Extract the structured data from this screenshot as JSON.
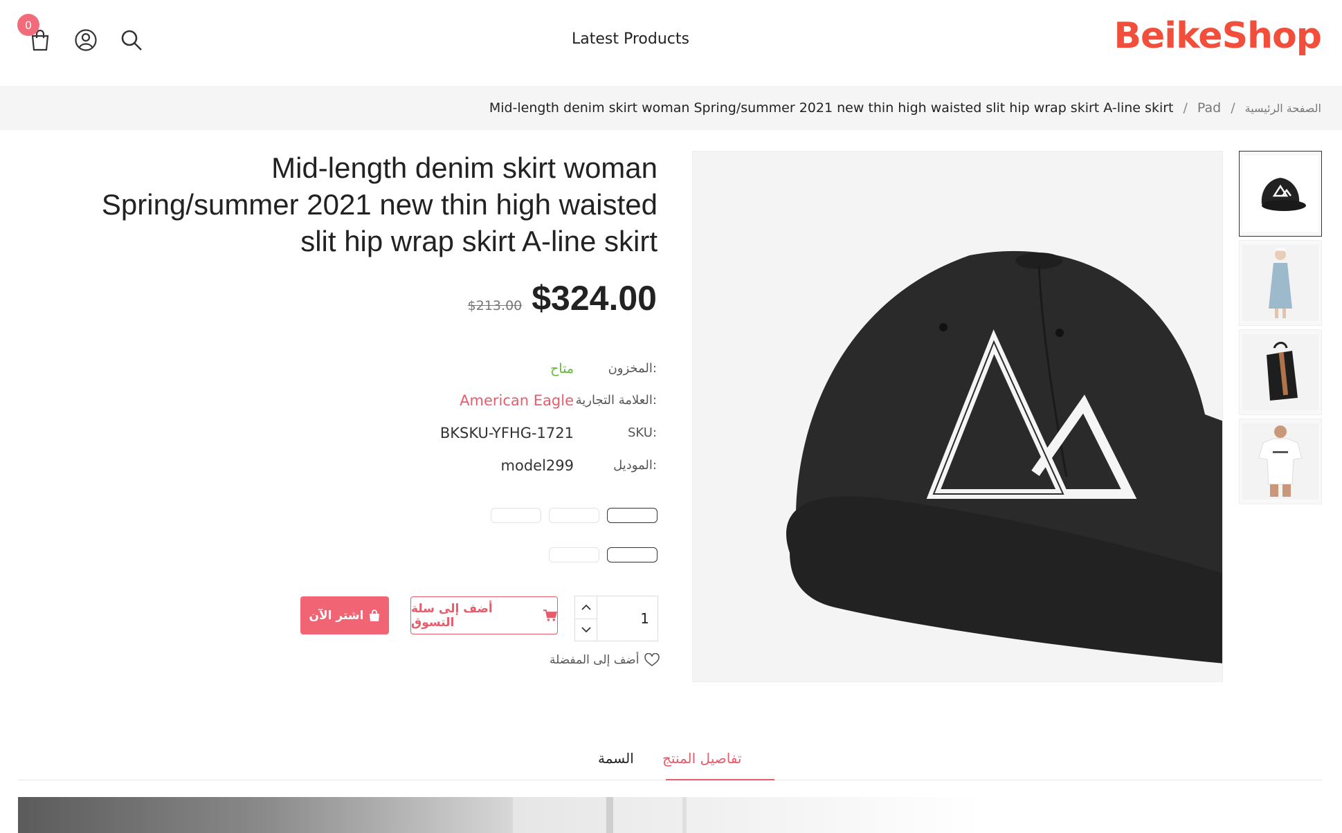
{
  "header": {
    "cart_count": "0",
    "nav_label": "Latest Products",
    "logo": "BeikeShop"
  },
  "breadcrumb": {
    "home": "الصفحة الرئيسية",
    "category": "Pad",
    "current": "Mid-length denim skirt woman Spring/summer 2021 new thin high waisted slit hip wrap skirt A-line skirt"
  },
  "product": {
    "title_line1": "Mid-length denim skirt woman",
    "title_line2": "Spring/summer 2021 new thin high waisted",
    "title_line3": "slit hip wrap skirt A-line skirt",
    "price": "$324.00",
    "old_price": "$213.00",
    "stock_label": "المخزون:",
    "stock_value": "متاح",
    "brand_label": "العلامة التجارية:",
    "brand_value": "American Eagle",
    "sku_label": "SKU:",
    "sku_value": "BKSKU-YFHG-1721",
    "model_label": "الموديل:",
    "model_value": "model299",
    "quantity": "1",
    "add_to_cart": "أضف إلى سلة التسوق",
    "buy_now": "اشتر الآن",
    "wishlist": "أضف إلى المفضلة"
  },
  "tabs": {
    "details": "تفاصيل المنتج",
    "attributes": "السمة"
  },
  "colors": {
    "accent": "#e85b6a",
    "logo": "#f14f3b",
    "stock": "#62b73c"
  }
}
